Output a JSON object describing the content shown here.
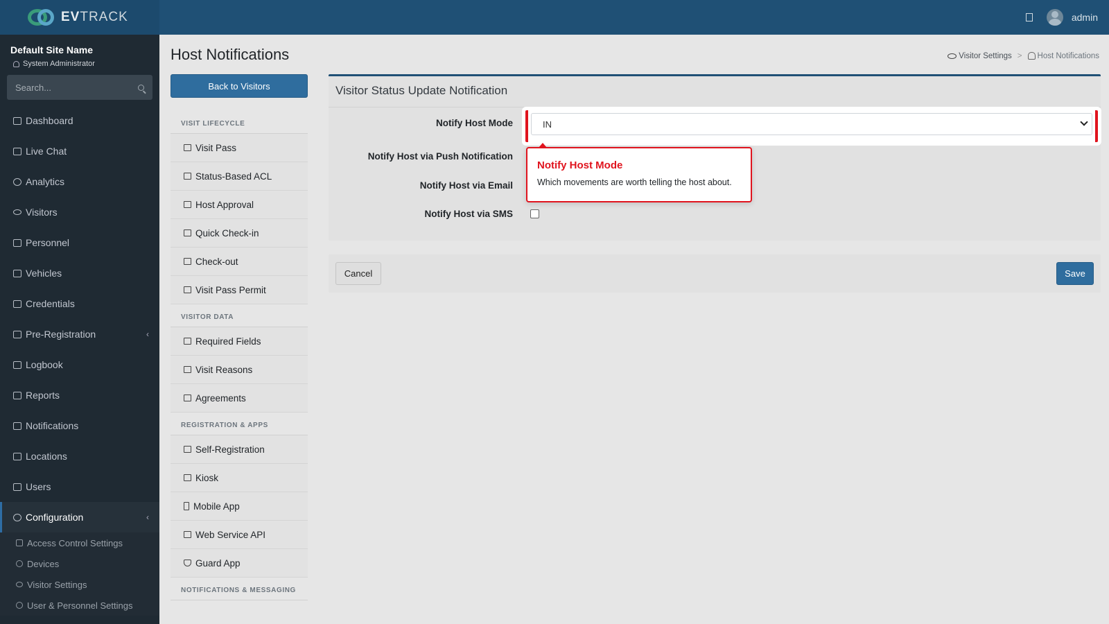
{
  "topbar": {
    "brand_prefix": "EV",
    "brand_suffix": "TRACK",
    "username": "admin"
  },
  "sidebar": {
    "site_name": "Default Site Name",
    "role": "System Administrator",
    "search_placeholder": "Search...",
    "items": [
      {
        "label": "Dashboard",
        "icon": "gauge-icon"
      },
      {
        "label": "Live Chat",
        "icon": "headset-icon"
      },
      {
        "label": "Analytics",
        "icon": "target-icon"
      },
      {
        "label": "Visitors",
        "icon": "eye-icon"
      },
      {
        "label": "Personnel",
        "icon": "users-icon"
      },
      {
        "label": "Vehicles",
        "icon": "car-icon"
      },
      {
        "label": "Credentials",
        "icon": "badge-icon"
      },
      {
        "label": "Pre-Registration",
        "icon": "arrows-icon"
      },
      {
        "label": "Logbook",
        "icon": "book-icon"
      },
      {
        "label": "Reports",
        "icon": "chart-icon"
      },
      {
        "label": "Notifications",
        "icon": "chat-icon"
      },
      {
        "label": "Locations",
        "icon": "map-icon"
      },
      {
        "label": "Users",
        "icon": "user-cog-icon"
      },
      {
        "label": "Configuration",
        "icon": "gear-icon"
      }
    ],
    "sub_items": [
      {
        "label": "Access Control Settings",
        "icon": "lock-icon"
      },
      {
        "label": "Devices",
        "icon": "gear-icon"
      },
      {
        "label": "Visitor Settings",
        "icon": "eye-icon"
      },
      {
        "label": "User & Personnel Settings",
        "icon": "user-cog-icon"
      }
    ]
  },
  "main": {
    "page_title": "Host Notifications",
    "breadcrumb": {
      "parent": "Visitor Settings",
      "current": "Host Notifications"
    },
    "back_button": "Back to Visitors"
  },
  "settings_menu": {
    "sections": [
      {
        "header": "VISIT LIFECYCLE",
        "items": [
          "Visit Pass",
          "Status-Based ACL",
          "Host Approval",
          "Quick Check-in",
          "Check-out",
          "Visit Pass Permit"
        ]
      },
      {
        "header": "VISITOR DATA",
        "items": [
          "Required Fields",
          "Visit Reasons",
          "Agreements"
        ]
      },
      {
        "header": "REGISTRATION & APPS",
        "items": [
          "Self-Registration",
          "Kiosk",
          "Mobile App",
          "Web Service API",
          "Guard App"
        ]
      },
      {
        "header": "NOTIFICATIONS & MESSAGING",
        "items": []
      }
    ]
  },
  "card": {
    "title": "Visitor Status Update Notification",
    "labels": {
      "mode": "Notify Host Mode",
      "push": "Notify Host via Push Notification",
      "email": "Notify Host via Email",
      "sms": "Notify Host via SMS"
    },
    "mode_value": "IN",
    "sms_checked": false
  },
  "tooltip": {
    "title": "Notify Host Mode",
    "body": "Which movements are worth telling the host about."
  },
  "footer": {
    "cancel": "Cancel",
    "save": "Save"
  },
  "colors": {
    "topbar": "#1f5075",
    "sidebar": "#1f2a33",
    "primary_button": "#2f6d9e",
    "highlight": "#e0141e"
  }
}
